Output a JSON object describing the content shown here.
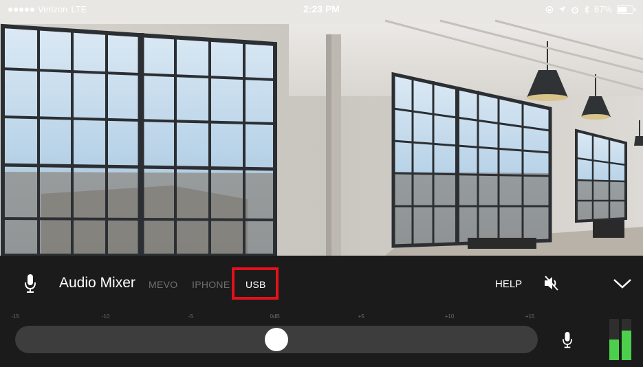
{
  "status_bar": {
    "carrier": "Verizon",
    "network": "LTE",
    "time": "2:23 PM",
    "battery": "67%",
    "battery_level": 0.67,
    "icons": [
      "signal-dots-icon",
      "lock-rotation-icon",
      "location-arrow-icon",
      "alarm-icon",
      "bluetooth-icon",
      "battery-icon"
    ]
  },
  "audio_mixer": {
    "title": "Audio Mixer",
    "sources": [
      {
        "label": "MEVO",
        "active": false
      },
      {
        "label": "IPHONE",
        "active": false
      },
      {
        "label": "USB",
        "active": true
      }
    ],
    "help_label": "HELP",
    "icons": [
      "microphone-icon",
      "speaker-mute-icon",
      "chevron-down-icon"
    ],
    "highlight_color": "#e3121a"
  },
  "gain_slider": {
    "ticks": [
      "-15",
      "-10",
      "-5",
      "0dB",
      "+5",
      "+10",
      "+15"
    ],
    "min": -15,
    "max": 15,
    "value": 0
  },
  "level_meter": {
    "labels": [
      "",
      ""
    ],
    "left_level": 0.5,
    "right_level": 0.72,
    "color": "#4cd04c"
  }
}
